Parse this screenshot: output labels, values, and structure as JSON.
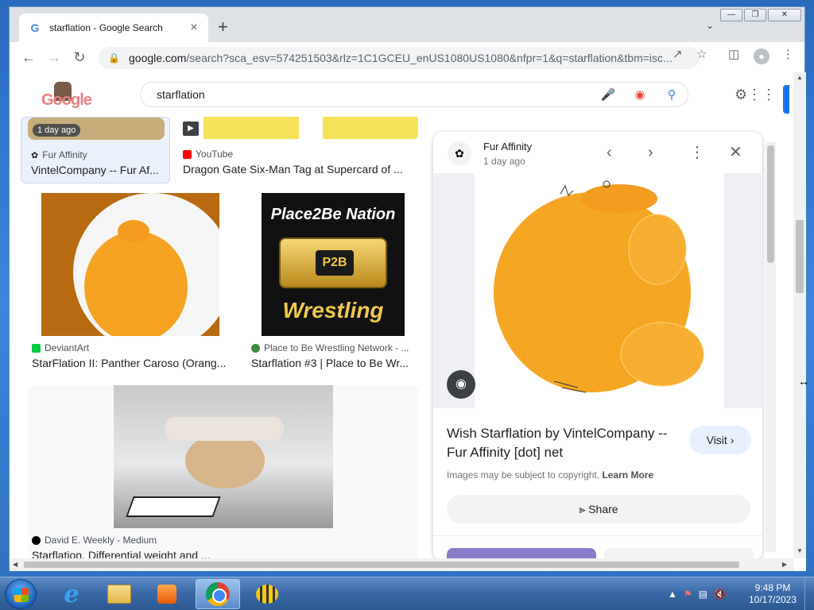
{
  "browser": {
    "tab_title": "starflation - Google Search",
    "url_host": "google.com",
    "url_rest": "/search?sca_esv=574251503&rlz=1C1GCEU_enUS1080US1080&nfpr=1&q=starflation&tbm=isc..."
  },
  "search": {
    "query": "starflation",
    "doodle_text": "Google"
  },
  "results": {
    "top_left": {
      "badge": "1 day ago",
      "source": "Fur Affinity",
      "title": "VintelCompany -- Fur Af..."
    },
    "top_right": {
      "source": "YouTube",
      "title": "Dragon Gate Six-Man Tag at Supercard of ..."
    },
    "mid_left": {
      "source": "DeviantArt",
      "title": "StarFlation II: Panther Caroso (Orang..."
    },
    "mid_right": {
      "source": "Place to Be Wrestling Network - ...",
      "title": "Starflation #3 | Place to Be Wr...",
      "img_line1": "Place2Be Nation",
      "img_logo": "P2B",
      "img_line2": "Wrestling"
    },
    "bottom": {
      "source": "David E. Weekly - Medium",
      "title": "Starflation. Differential weight and ..."
    }
  },
  "panel": {
    "source": "Fur Affinity",
    "age": "1 day ago",
    "title": "Wish Starflation by VintelCompany -- Fur Affinity [dot] net",
    "visit_label": "Visit",
    "copyright": "Images may be subject to copyright.",
    "learn_more": "Learn More",
    "share_label": "Share"
  },
  "taskbar": {
    "time": "9:48 PM",
    "date": "10/17/2023"
  },
  "colors": {
    "accent": "#1a73e8",
    "orange": "#f5a623"
  }
}
